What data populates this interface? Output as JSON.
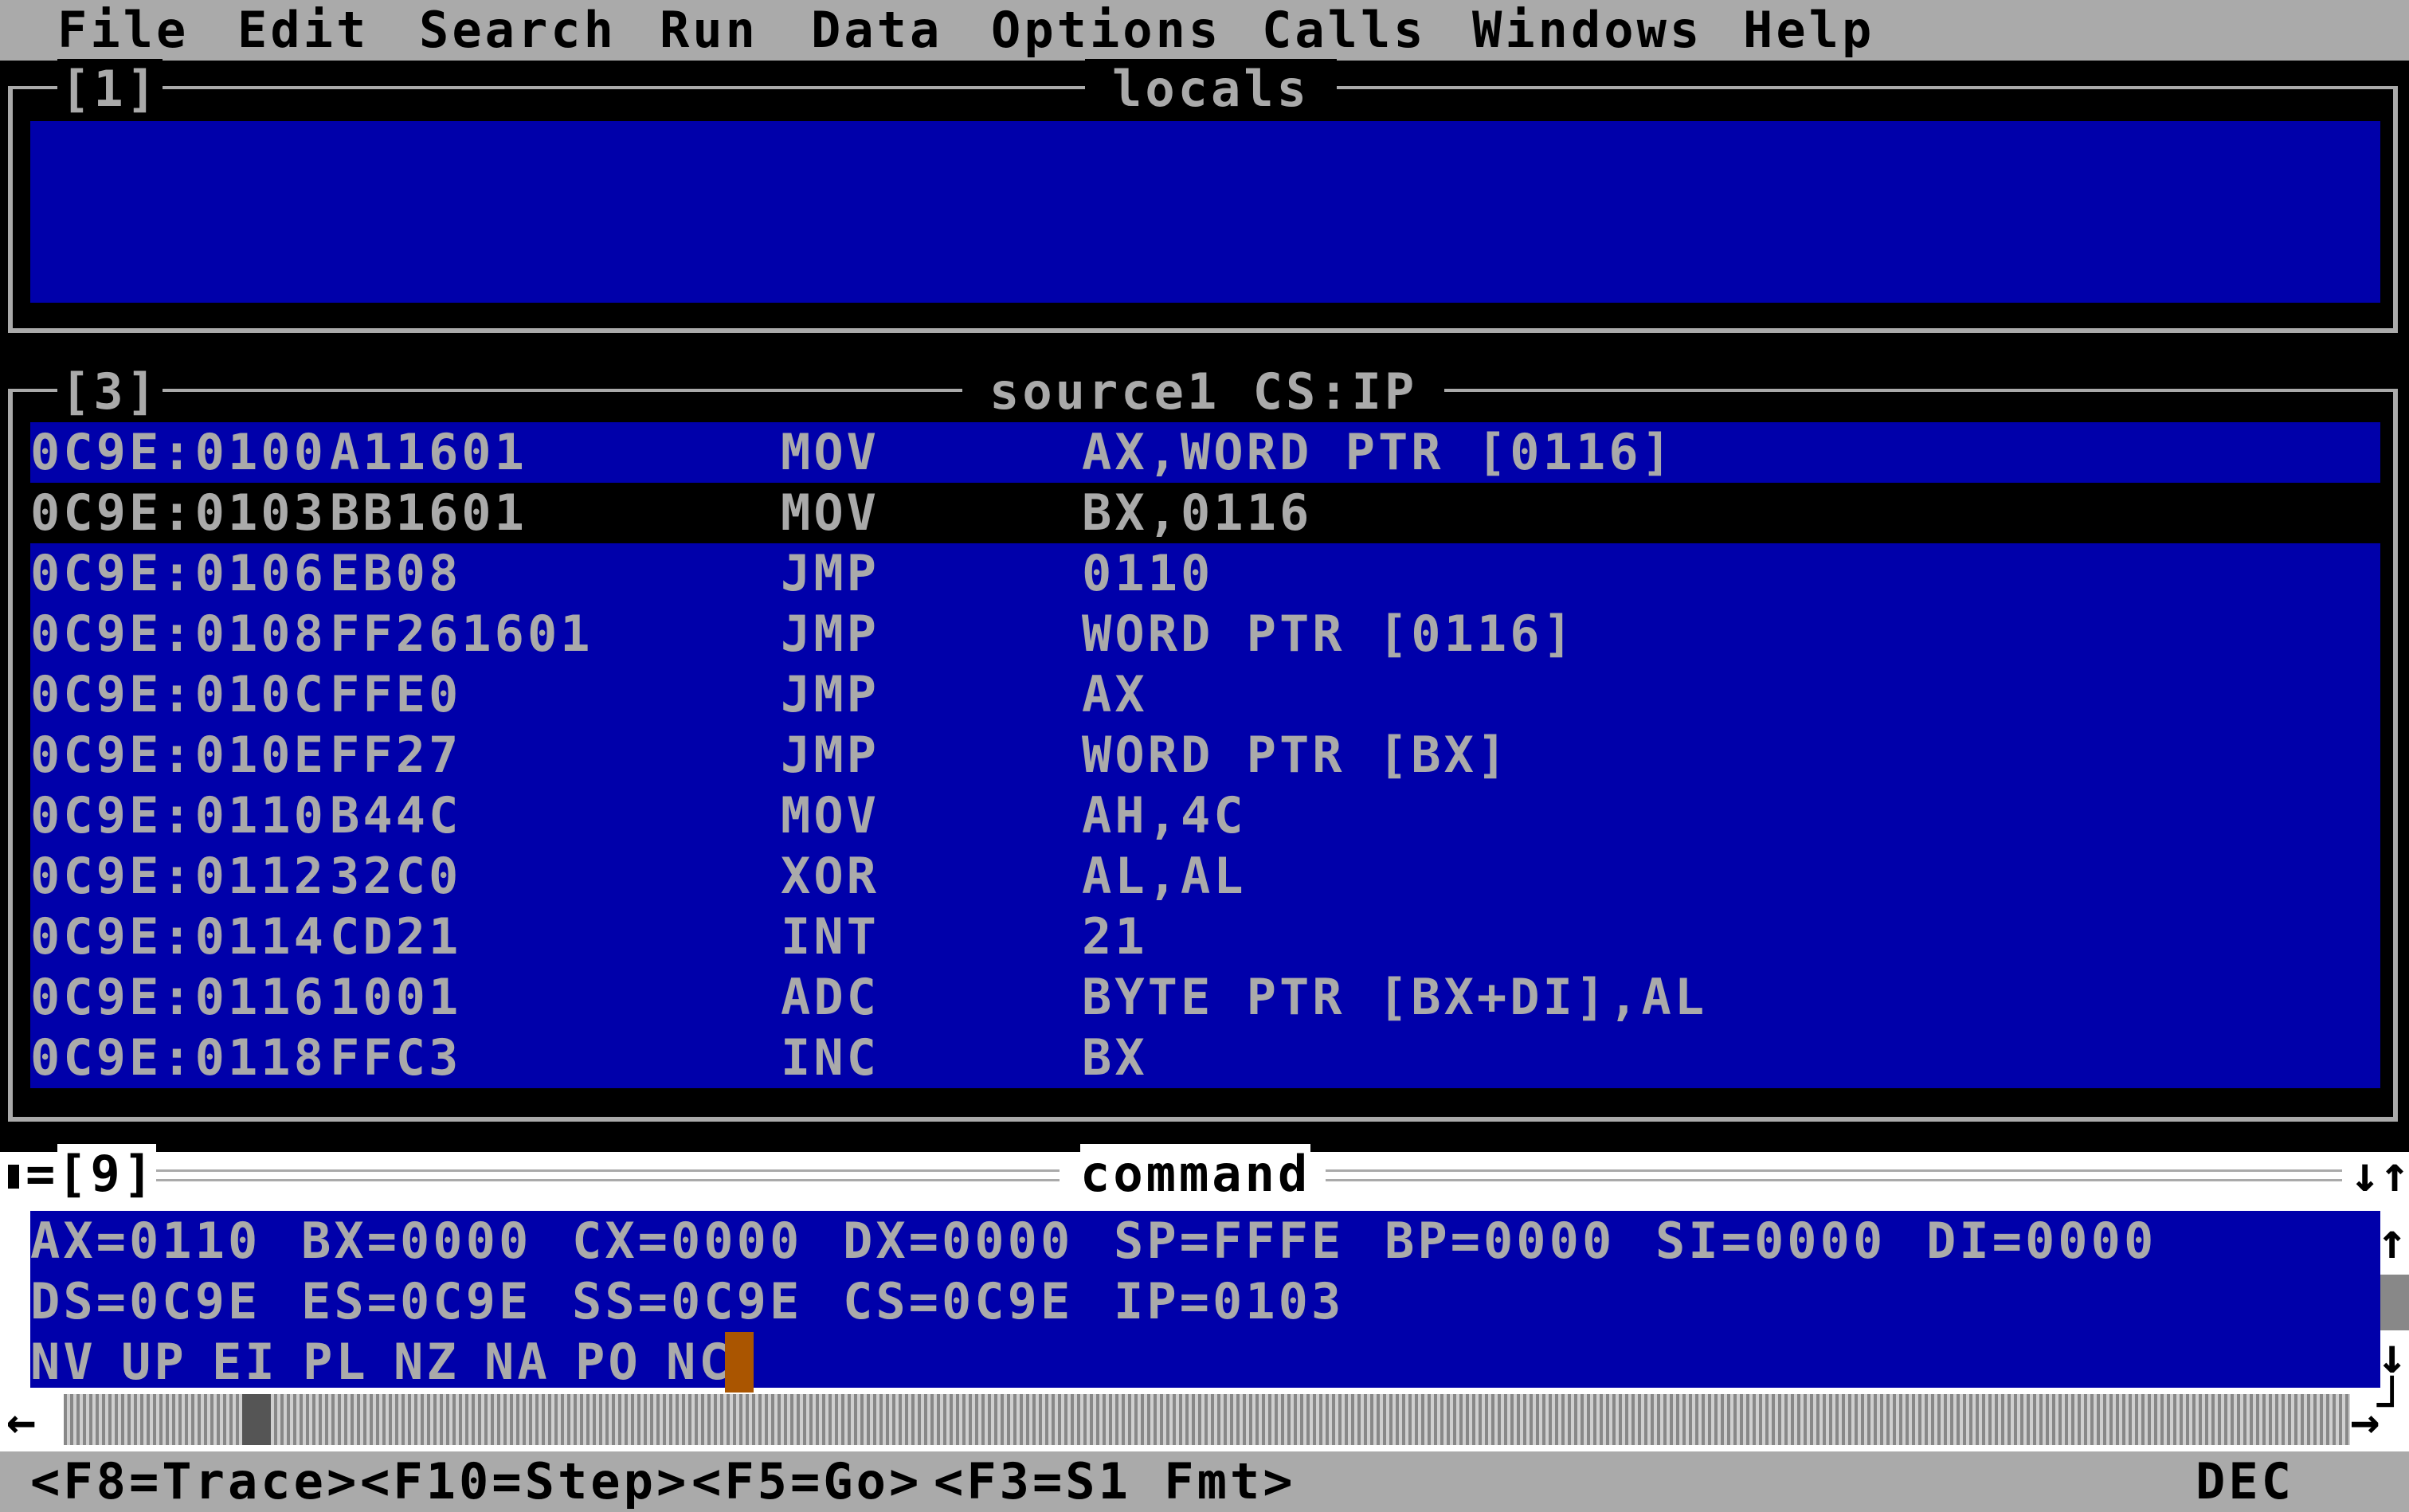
{
  "menu": {
    "items": [
      "File",
      "Edit",
      "Search",
      "Run",
      "Data",
      "Options",
      "Calls",
      "Windows",
      "Help"
    ]
  },
  "locals_window": {
    "number": "[1]",
    "title": "locals"
  },
  "source_window": {
    "number": "[3]",
    "title": "source1 CS:IP",
    "lines": [
      {
        "addr": "0C9E:0100",
        "bytes": "A11601",
        "mnemonic": "MOV",
        "operands": "AX,WORD PTR [0116]"
      },
      {
        "addr": "0C9E:0103",
        "bytes": "BB1601",
        "mnemonic": "MOV",
        "operands": "BX,0116"
      },
      {
        "addr": "0C9E:0106",
        "bytes": "EB08",
        "mnemonic": "JMP",
        "operands": "0110"
      },
      {
        "addr": "0C9E:0108",
        "bytes": "FF261601",
        "mnemonic": "JMP",
        "operands": "WORD PTR [0116]"
      },
      {
        "addr": "0C9E:010C",
        "bytes": "FFE0",
        "mnemonic": "JMP",
        "operands": "AX"
      },
      {
        "addr": "0C9E:010E",
        "bytes": "FF27",
        "mnemonic": "JMP",
        "operands": "WORD PTR [BX]"
      },
      {
        "addr": "0C9E:0110",
        "bytes": "B44C",
        "mnemonic": "MOV",
        "operands": "AH,4C"
      },
      {
        "addr": "0C9E:0112",
        "bytes": "32C0",
        "mnemonic": "XOR",
        "operands": "AL,AL"
      },
      {
        "addr": "0C9E:0114",
        "bytes": "CD21",
        "mnemonic": "INT",
        "operands": "21"
      },
      {
        "addr": "0C9E:0116",
        "bytes": "1001",
        "mnemonic": "ADC",
        "operands": "BYTE PTR [BX+DI],AL"
      },
      {
        "addr": "0C9E:0118",
        "bytes": "FFC3",
        "mnemonic": "INC",
        "operands": "BX"
      }
    ],
    "current_line_index": 1
  },
  "command_window": {
    "number": "[9]",
    "title": "command",
    "registers_row1": [
      "AX=0110",
      "BX=0000",
      "CX=0000",
      "DX=0000",
      "SP=FFFE",
      "BP=0000",
      "SI=0000",
      "DI=0000"
    ],
    "registers_row2": [
      "DS=0C9E",
      "ES=0C9E",
      "SS=0C9E",
      "CS=0C9E",
      "IP=0103"
    ],
    "flags": [
      "NV",
      "UP",
      "EI",
      "PL",
      "NZ",
      "NA",
      "PO",
      "NC"
    ]
  },
  "status_bar": {
    "keys": [
      "<F8=Trace>",
      "<F10=Step>",
      "<F5=Go>",
      "<F3=S1 Fmt>"
    ],
    "mode": "DEC"
  },
  "icons": {
    "close": "close-icon",
    "minimize_maximize": "arrows-icon",
    "scroll_up": "arrow-up-icon",
    "scroll_down": "arrow-down-icon",
    "scroll_left": "arrow-left-icon",
    "scroll_right": "arrow-right-icon",
    "resize": "resize-icon"
  },
  "colors": {
    "window_blue": "#0000aa",
    "text_gray": "#aaaaaa",
    "cursor": "#aa5500"
  }
}
